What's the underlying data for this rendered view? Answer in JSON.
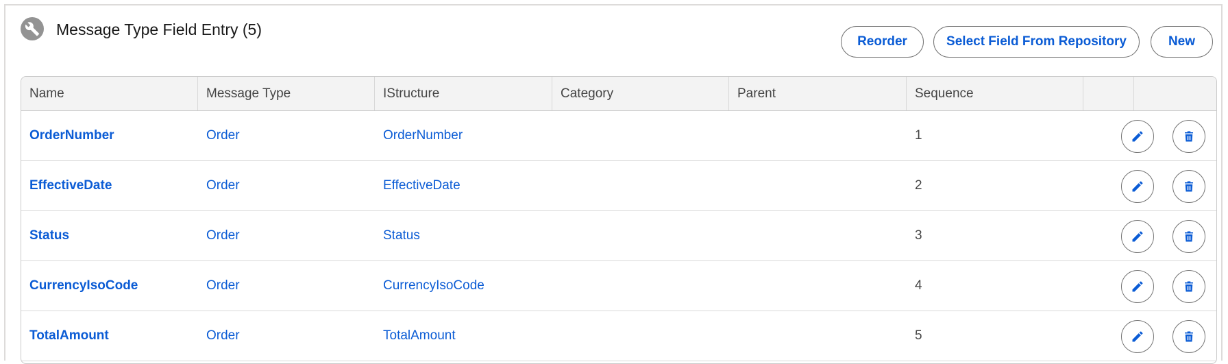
{
  "header": {
    "icon": "wrench-icon",
    "title": "Message Type Field Entry (5)"
  },
  "actions": {
    "reorder_label": "Reorder",
    "select_label": "Select Field From Repository",
    "new_label": "New"
  },
  "table": {
    "columns": [
      "Name",
      "Message Type",
      "IStructure",
      "Category",
      "Parent",
      "Sequence",
      "",
      ""
    ],
    "rows": [
      {
        "name": "OrderNumber",
        "message_type": "Order",
        "istructure": "OrderNumber",
        "category": "",
        "parent": "",
        "sequence": "1"
      },
      {
        "name": "EffectiveDate",
        "message_type": "Order",
        "istructure": "EffectiveDate",
        "category": "",
        "parent": "",
        "sequence": "2"
      },
      {
        "name": "Status",
        "message_type": "Order",
        "istructure": "Status",
        "category": "",
        "parent": "",
        "sequence": "3"
      },
      {
        "name": "CurrencyIsoCode",
        "message_type": "Order",
        "istructure": "CurrencyIsoCode",
        "category": "",
        "parent": "",
        "sequence": "4"
      },
      {
        "name": "TotalAmount",
        "message_type": "Order",
        "istructure": "TotalAmount",
        "category": "",
        "parent": "",
        "sequence": "5"
      }
    ],
    "row_actions": [
      "pencil-icon",
      "trash-icon"
    ]
  },
  "colors": {
    "link": "#0b5cd5",
    "header_bg": "#f3f3f3",
    "icon_bg": "#939393",
    "border": "#c9c9c9"
  }
}
